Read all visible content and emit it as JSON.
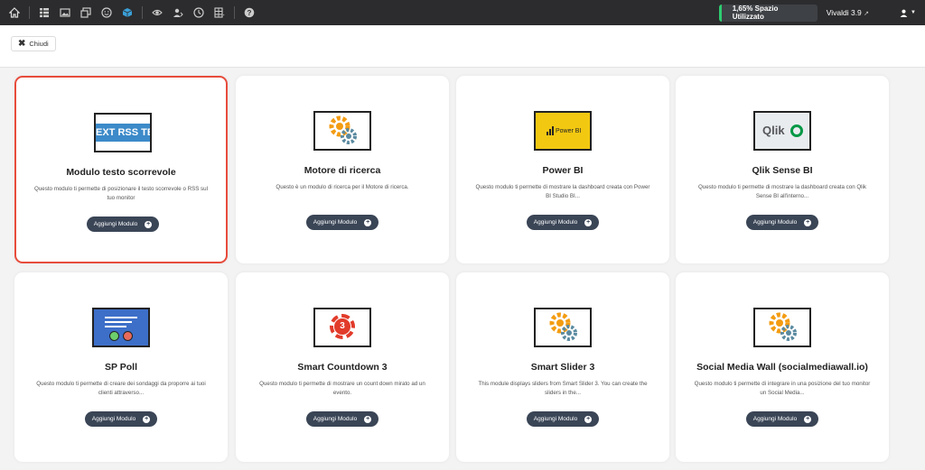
{
  "topbar": {
    "icons": [
      "home-icon",
      "list-icon",
      "image-icon",
      "copy-icon",
      "smile-icon",
      "cube-icon",
      "eye-icon",
      "users-icon",
      "clock-icon",
      "grid-icon",
      "help-icon"
    ],
    "storage_label": "1,65% Spazio Utilizzato",
    "storage_percent": 1.65,
    "storage_accent": "#2ecc71",
    "version_label": "Vivaldi 3.9",
    "user_icon": "user-icon"
  },
  "closebar": {
    "close_label": "Chiudi"
  },
  "cards": [
    {
      "title": "Modulo testo scorrevole",
      "desc": "Questo modulo ti permette di posizionare il testo scorrevole o RSS sul tuo monitor",
      "button": "Aggiungi Modulo",
      "thumb": "rss",
      "thumb_text": "EXT RSS TEXT"
    },
    {
      "title": "Motore di ricerca",
      "desc": "Questo è un modulo di ricerca per il Motore di ricerca.",
      "button": "Aggiungi Modulo",
      "thumb": "gear"
    },
    {
      "title": "Power BI",
      "desc": "Questo modulo ti permette di mostrare la dashboard creata con Power BI Studio BI...",
      "button": "Aggiungi Modulo",
      "thumb": "powerbi",
      "thumb_text": "Power BI"
    },
    {
      "title": "Qlik Sense BI",
      "desc": "Questo modulo ti permette di mostrare la dashboard creata con Qlik Sense BI all'interno...",
      "button": "Aggiungi Modulo",
      "thumb": "qlik",
      "thumb_text": "Qlik"
    },
    {
      "title": "SP Poll",
      "desc": "Questo modulo ti permette di creare dei sondaggi da proporre ai tuoi clienti attraverso...",
      "button": "Aggiungi Modulo",
      "thumb": "poll"
    },
    {
      "title": "Smart Countdown 3",
      "desc": "Questo modulo ti permette di mostrare un count down mirato ad un evento.",
      "button": "Aggiungi Modulo",
      "thumb": "countdown",
      "thumb_text": "3"
    },
    {
      "title": "Smart Slider 3",
      "desc": "This module displays sliders from Smart Slider 3. You can create the sliders in the...",
      "button": "Aggiungi Modulo",
      "thumb": "gear"
    },
    {
      "title": "Social Media Wall (socialmediawall.io)",
      "desc": "Questo modulo ti permette di integrare in una posizione del tuo monitor un Social Media...",
      "button": "Aggiungi Modulo",
      "thumb": "gear"
    }
  ],
  "colors": {
    "selected_border": "#e74c3c",
    "button_bg": "#3a4556",
    "topbar_bg": "#2c2c2e"
  }
}
